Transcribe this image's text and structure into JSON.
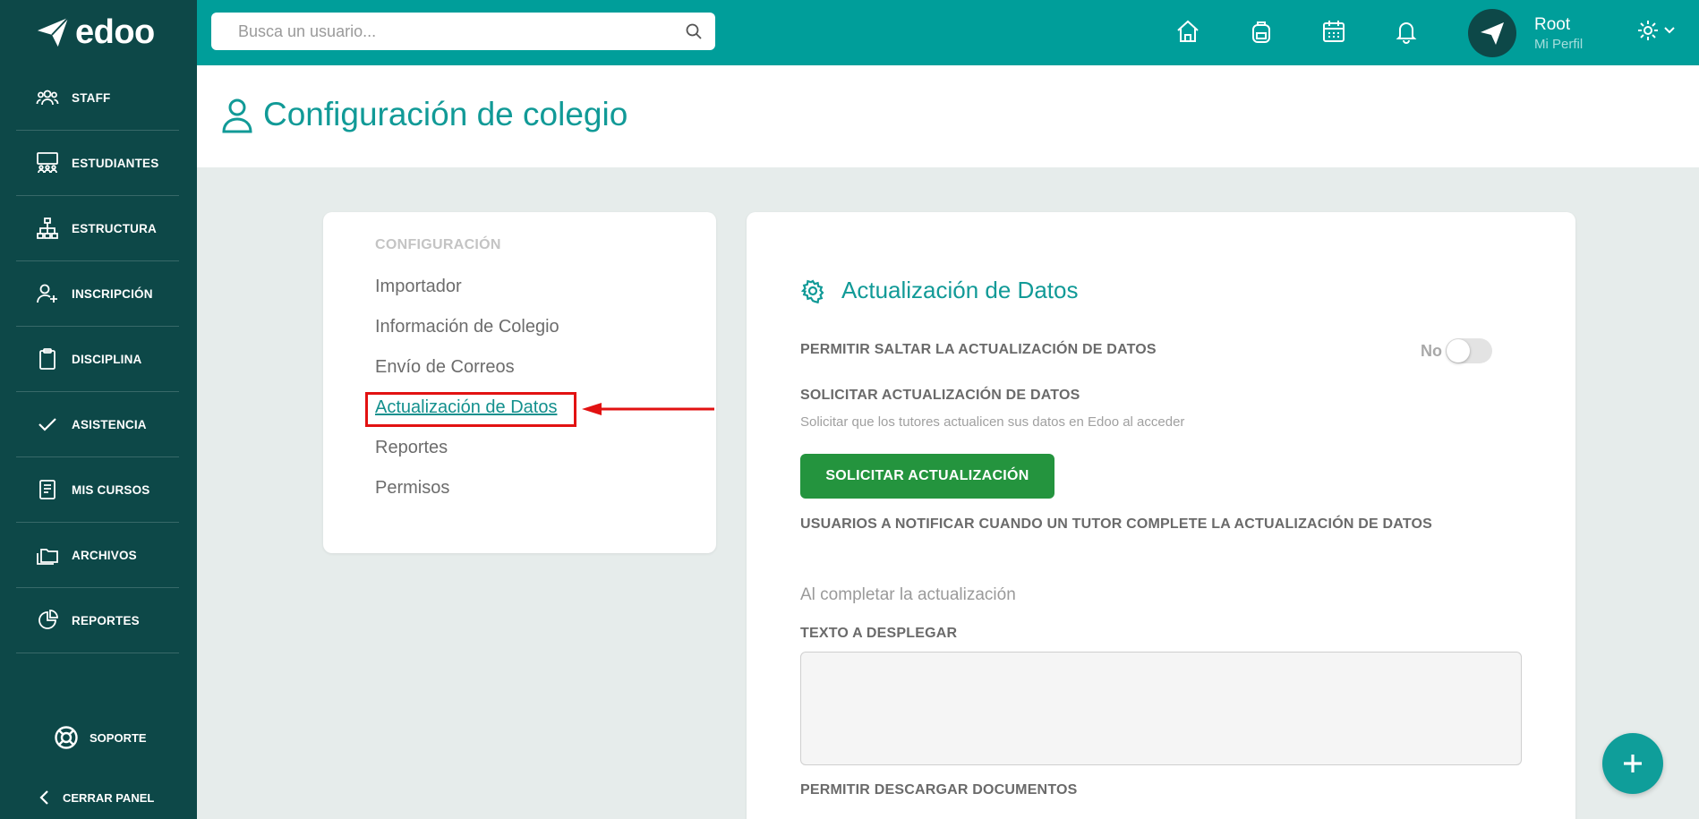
{
  "app": {
    "logo_text": "edoo"
  },
  "sidebar": {
    "items": [
      {
        "label": "STAFF",
        "icon": "staff-icon"
      },
      {
        "label": "ESTUDIANTES",
        "icon": "students-icon"
      },
      {
        "label": "ESTRUCTURA",
        "icon": "structure-icon"
      },
      {
        "label": "INSCRIPCIÓN",
        "icon": "add-user-icon"
      },
      {
        "label": "DISCIPLINA",
        "icon": "clipboard-icon"
      },
      {
        "label": "ASISTENCIA",
        "icon": "check-icon"
      },
      {
        "label": "MIS CURSOS",
        "icon": "book-icon"
      },
      {
        "label": "ARCHIVOS",
        "icon": "folder-icon"
      },
      {
        "label": "REPORTES",
        "icon": "pie-chart-icon"
      }
    ],
    "support_label": "SOPORTE",
    "close_label": "CERRAR PANEL"
  },
  "topbar": {
    "search_placeholder": "Busca un usuario...",
    "icons": [
      "home-icon",
      "backpack-icon",
      "calendar-icon",
      "bell-icon"
    ],
    "user_name": "Root",
    "user_subtitle": "Mi Perfil"
  },
  "page": {
    "title": "Configuración de colegio"
  },
  "config_menu": {
    "heading": "CONFIGURACIÓN",
    "items": [
      "Importador",
      "Información de Colegio",
      "Envío de Correos",
      "Actualización de Datos",
      "Reportes",
      "Permisos"
    ],
    "active_index": 3
  },
  "section": {
    "title": "Actualización de Datos",
    "allow_skip_label": "PERMITIR SALTAR LA ACTUALIZACIÓN DE DATOS",
    "toggle_value": "No",
    "request_label": "SOLICITAR ACTUALIZACIÓN DE DATOS",
    "request_help": "Solicitar que los tutores actualicen sus datos en Edoo al acceder",
    "request_button": "SOLICITAR ACTUALIZACIÓN",
    "notify_label": "USUARIOS A NOTIFICAR CUANDO UN TUTOR COMPLETE LA ACTUALIZACIÓN DE DATOS",
    "on_complete_heading": "Al completar la actualización",
    "display_text_label": "TEXTO A DESPLEGAR",
    "allow_download_label": "PERMITIR DESCARGAR DOCUMENTOS"
  },
  "colors": {
    "sidebar": "#0d4848",
    "topbar": "#009e9a",
    "accent": "#119a97",
    "button_green": "#24943e",
    "highlight_red": "#e21212"
  }
}
